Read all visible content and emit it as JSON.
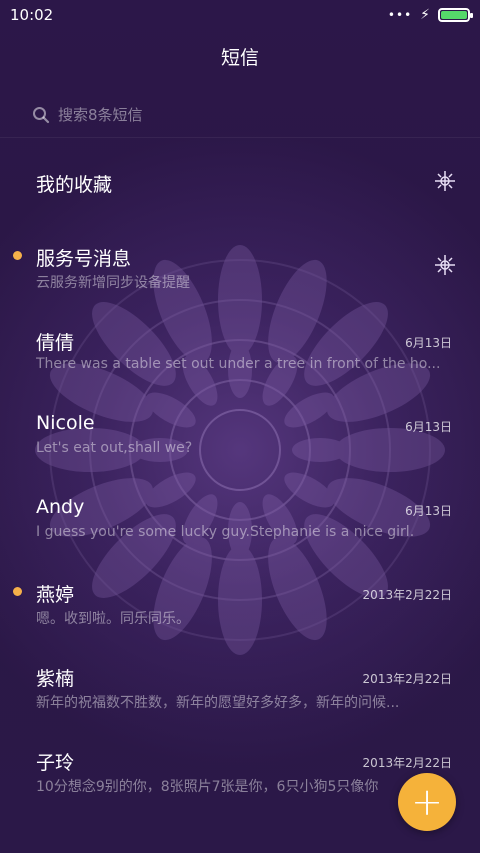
{
  "status": {
    "time": "10:02",
    "dots": "•••",
    "bolt": "⚡"
  },
  "header": {
    "title": "短信"
  },
  "search": {
    "placeholder": "搜索8条短信"
  },
  "favorites": {
    "label": "我的收藏",
    "icon": "decorative-ornament-icon"
  },
  "service": {
    "name": "服务号消息",
    "preview": "云服务新增同步设备提醒",
    "unread": true,
    "icon": "decorative-ornament-icon"
  },
  "conversations": [
    {
      "name": "倩倩",
      "preview": "There was a table set out under a tree in front of the ho...",
      "date": "6月13日",
      "unread": false
    },
    {
      "name": "Nicole",
      "preview": "Let's eat out,shall we?",
      "date": "6月13日",
      "unread": false
    },
    {
      "name": "Andy",
      "preview": "I guess you're some lucky guy.Stephanie is a nice girl.",
      "date": "6月13日",
      "unread": false
    },
    {
      "name": "燕婷",
      "preview": "嗯。收到啦。同乐同乐。",
      "date": "2013年2月22日",
      "unread": true
    },
    {
      "name": "紫楠",
      "preview": "新年的祝福数不胜数，新年的愿望好多好多，新年的问候...",
      "date": "2013年2月22日",
      "unread": false
    },
    {
      "name": "子玲",
      "preview": "10分想念9别的你，8张照片7张是你，6只小狗5只像你",
      "date": "2013年2月22日",
      "unread": false
    }
  ],
  "fab": {
    "label": "+"
  },
  "colors": {
    "background": "#2a1747",
    "accent": "#f5b23a",
    "unread_dot": "#f5b04a",
    "battery": "#55d96a"
  }
}
